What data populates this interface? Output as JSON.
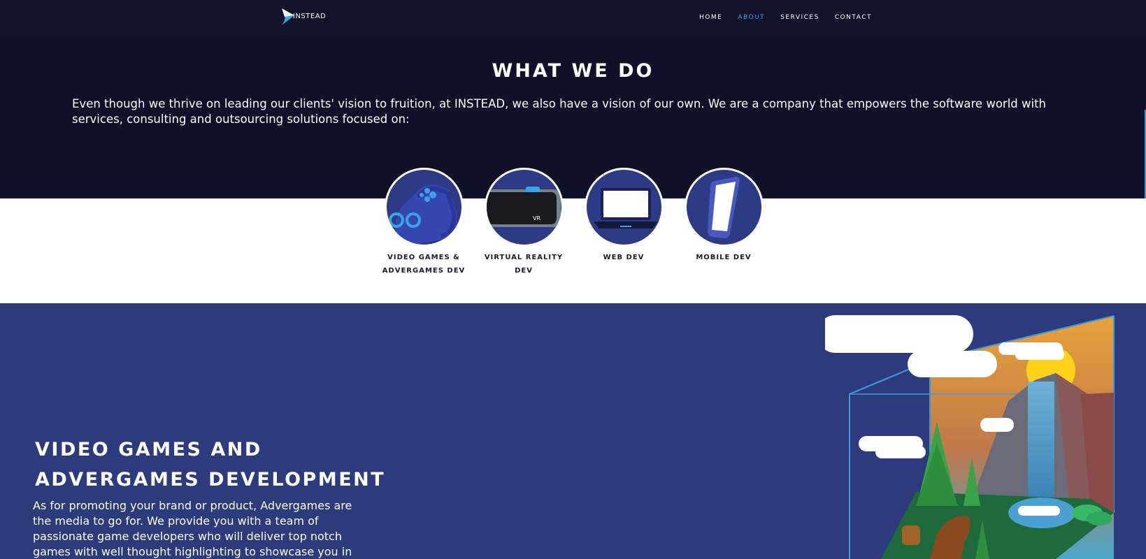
{
  "header": {
    "logo_text": "INSTEAD",
    "nav": [
      {
        "label": "HOME",
        "active": false
      },
      {
        "label": "ABOUT",
        "active": true
      },
      {
        "label": "SERVICES",
        "active": false
      },
      {
        "label": "CONTACT",
        "active": false
      }
    ],
    "accent_color": "#3aa4e8"
  },
  "what_we_do": {
    "title": "WHAT WE DO",
    "text": "Even though we thrive on leading our clients' vision to fruition, at INSTEAD, we also have a vision of our own. We are a company that empowers the software world with services, consulting and outsourcing solutions focused on:"
  },
  "services": [
    {
      "label": "VIDEO GAMES & ADVERGAMES DEV",
      "icon": "gamepad-icon"
    },
    {
      "label": "VIRTUAL REALITY DEV",
      "icon": "vr-headset-icon",
      "icon_text": "VR"
    },
    {
      "label": "WEB DEV",
      "icon": "laptop-icon"
    },
    {
      "label": "MOBILE DEV",
      "icon": "smartphone-icon"
    }
  ],
  "games_section": {
    "title_line1": "VIDEO GAMES AND",
    "title_line2": "ADVERGAMES DEVELOPMENT",
    "text": "As for promoting your brand or product, Advergames are the media to go for. We provide you with a team of passionate game developers who will deliver top notch games with well thought highlighting to showcase you in the best way possible.",
    "illustration": "isometric-landscape-illustration",
    "background_color": "#2d3b7d"
  }
}
